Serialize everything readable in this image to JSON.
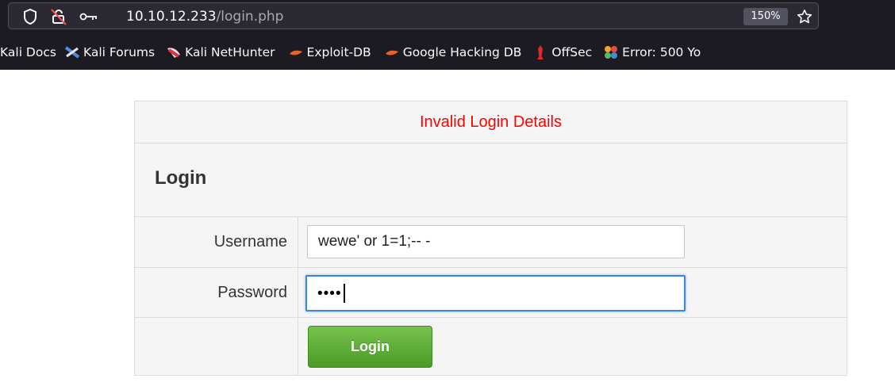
{
  "browser": {
    "url_host": "10.10.12.233",
    "url_path": "/login.php",
    "zoom_level": "150%",
    "icons": [
      "shield-icon",
      "permissions-icon",
      "key-icon",
      "bookmark-star-icon"
    ],
    "bookmarks": [
      {
        "label": "Kali Docs",
        "icon": "kali-docs-icon"
      },
      {
        "label": "Kali Forums",
        "icon": "kali-forums-icon"
      },
      {
        "label": "Kali NetHunter",
        "icon": "kali-nethunter-icon"
      },
      {
        "label": "Exploit-DB",
        "icon": "exploit-db-icon"
      },
      {
        "label": "Google Hacking DB",
        "icon": "ghdb-icon"
      },
      {
        "label": "OffSec",
        "icon": "offsec-icon"
      },
      {
        "label": "Error: 500 Yo",
        "icon": "joomla-icon"
      }
    ]
  },
  "login_form": {
    "error_message": "Invalid Login Details",
    "heading": "Login",
    "username_label": "Username",
    "username_value": "wewe' or 1=1;-- -",
    "password_label": "Password",
    "password_masked": "••••",
    "submit_label": "Login"
  },
  "colors": {
    "error_text": "#ff0000",
    "button_green": "#5aad35",
    "focus_blue": "#3d85d6",
    "chrome_bg": "#1c1b22"
  }
}
